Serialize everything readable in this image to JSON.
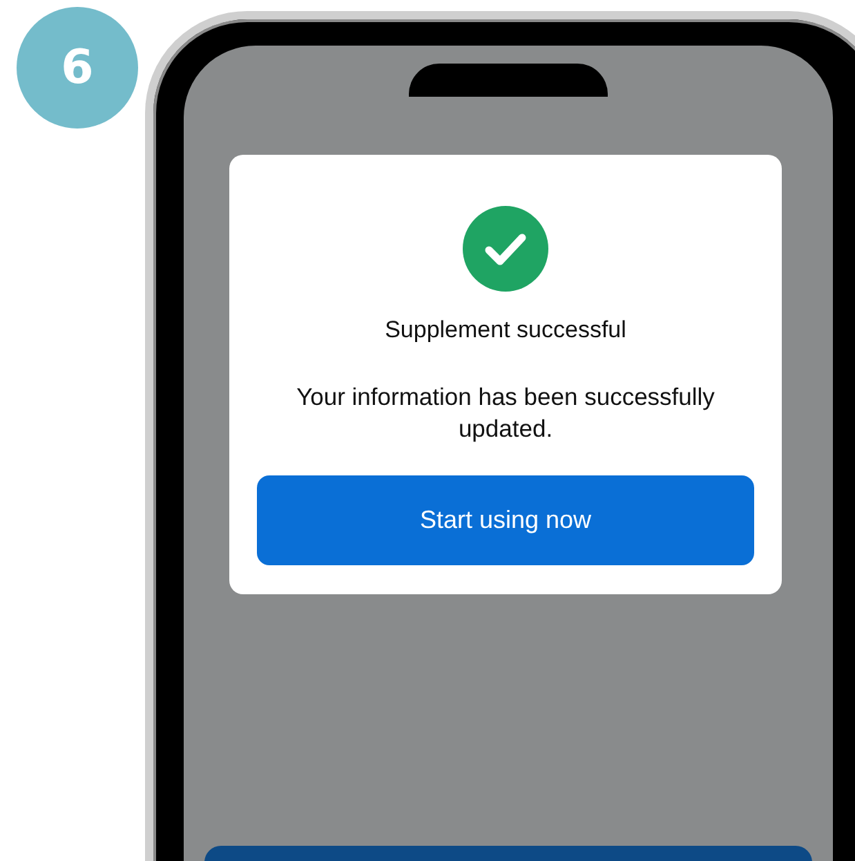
{
  "step_badge": "6",
  "dialog": {
    "title": "Supplement successful",
    "message": "Your information has been successfully updated.",
    "button": "Start using now"
  }
}
